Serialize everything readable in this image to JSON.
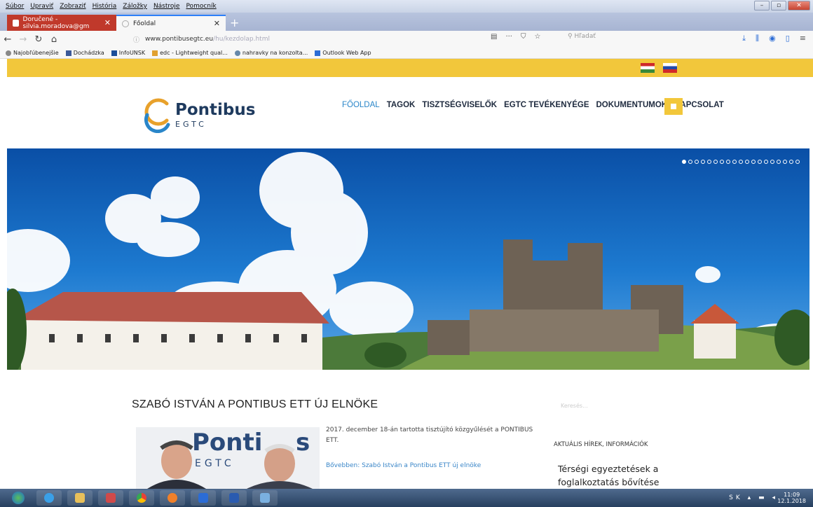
{
  "menu": [
    "Súbor",
    "Upraviť",
    "Zobraziť",
    "História",
    "Záložky",
    "Nástroje",
    "Pomocník"
  ],
  "tabs": [
    {
      "label": "Doručené - silvia.moradova@gm"
    },
    {
      "label": "Főoldal"
    }
  ],
  "url": {
    "domain": "www.pontibusegtc.eu",
    "path": "/hu/kezdolap.html"
  },
  "search": {
    "placeholder": "Hľadať"
  },
  "bookmarks": [
    "Najobľúbenejšie",
    "Dochádzka",
    "InfoUNSK",
    "edc - Lightweight qual...",
    "nahravky na konzolta...",
    "Outlook Web App"
  ],
  "site": {
    "logo_name": "Pontibus",
    "logo_sub": "EGTC",
    "nav": [
      "FŐOLDAL",
      "TAGOK",
      "TISZTSÉGVISELŐK",
      "EGTC TEVÉKENYÉGE",
      "DOKUMENTUMOK",
      "KAPCSOLAT"
    ]
  },
  "article": {
    "title": "SZABÓ ISTVÁN A PONTIBUS ETT ÚJ ELNÖKE",
    "text": "2017. december 18-án tartotta tisztújító közgyűlését a PONTIBUS ETT.",
    "link": "Bővebben: Szabó István a Pontibus ETT új elnöke",
    "image_logo": "Ponti",
    "image_logo_end": "s",
    "image_sub": "EGTC"
  },
  "sidebar": {
    "search_hint": "Keresés...",
    "heading": "AKTUÁLIS HÍREK, INFORMÁCIÓK",
    "news": "Térségi egyeztetések a foglalkoztatás bővítése"
  },
  "tray": {
    "lang": "SK",
    "time": "11:09",
    "date": "12.1.2018"
  },
  "colors": {
    "accent_yellow": "#f2c73b",
    "brand_navy": "#1e3a5e",
    "link_blue": "#3a86c8"
  }
}
